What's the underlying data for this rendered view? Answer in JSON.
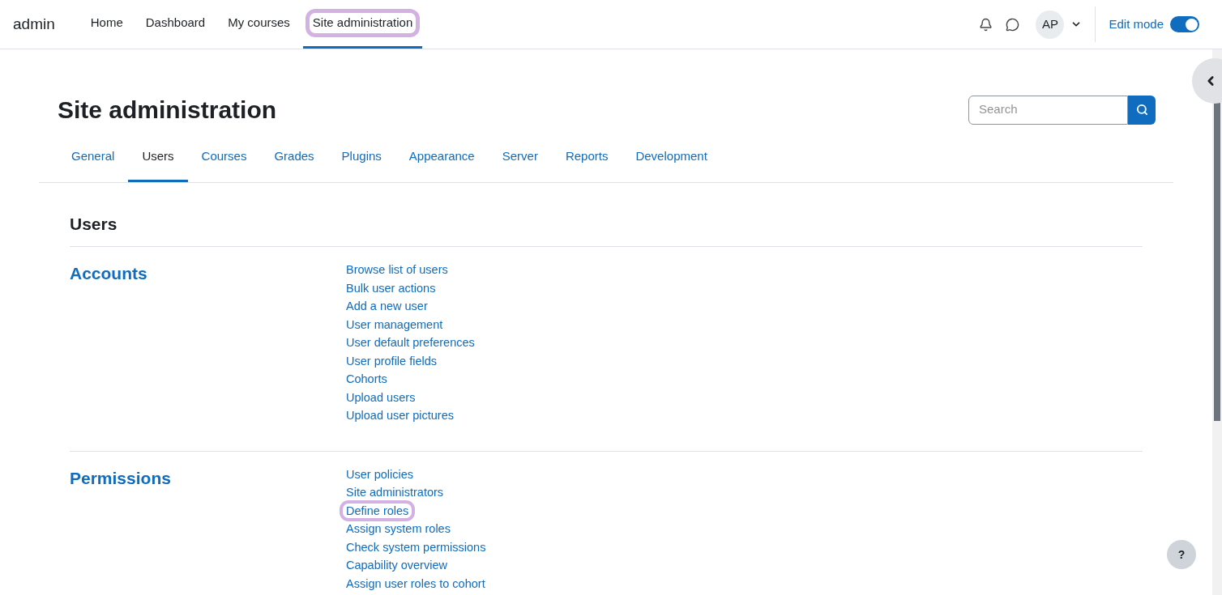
{
  "navbar": {
    "brand": "admin",
    "items": [
      {
        "label": "Home",
        "selected": false,
        "highlighted": false
      },
      {
        "label": "Dashboard",
        "selected": false,
        "highlighted": false
      },
      {
        "label": "My courses",
        "selected": false,
        "highlighted": false
      },
      {
        "label": "Site administration",
        "selected": true,
        "highlighted": true
      }
    ],
    "avatar": "AP",
    "edit_mode": {
      "label": "Edit mode",
      "on": true
    }
  },
  "page": {
    "title": "Site administration",
    "search": {
      "placeholder": "Search"
    },
    "tabs": [
      {
        "label": "General",
        "selected": false
      },
      {
        "label": "Users",
        "selected": true
      },
      {
        "label": "Courses",
        "selected": false
      },
      {
        "label": "Grades",
        "selected": false
      },
      {
        "label": "Plugins",
        "selected": false
      },
      {
        "label": "Appearance",
        "selected": false
      },
      {
        "label": "Server",
        "selected": false
      },
      {
        "label": "Reports",
        "selected": false
      },
      {
        "label": "Development",
        "selected": false
      }
    ],
    "section_title": "Users",
    "groups": [
      {
        "title": "Accounts",
        "links": [
          {
            "label": "Browse list of users",
            "highlighted": false
          },
          {
            "label": "Bulk user actions",
            "highlighted": false
          },
          {
            "label": "Add a new user",
            "highlighted": false
          },
          {
            "label": "User management",
            "highlighted": false
          },
          {
            "label": "User default preferences",
            "highlighted": false
          },
          {
            "label": "User profile fields",
            "highlighted": false
          },
          {
            "label": "Cohorts",
            "highlighted": false
          },
          {
            "label": "Upload users",
            "highlighted": false
          },
          {
            "label": "Upload user pictures",
            "highlighted": false
          }
        ]
      },
      {
        "title": "Permissions",
        "links": [
          {
            "label": "User policies",
            "highlighted": false
          },
          {
            "label": "Site administrators",
            "highlighted": false
          },
          {
            "label": "Define roles",
            "highlighted": true
          },
          {
            "label": "Assign system roles",
            "highlighted": false
          },
          {
            "label": "Check system permissions",
            "highlighted": false
          },
          {
            "label": "Capability overview",
            "highlighted": false
          },
          {
            "label": "Assign user roles to cohort",
            "highlighted": false
          }
        ]
      }
    ]
  },
  "help_button": "?"
}
